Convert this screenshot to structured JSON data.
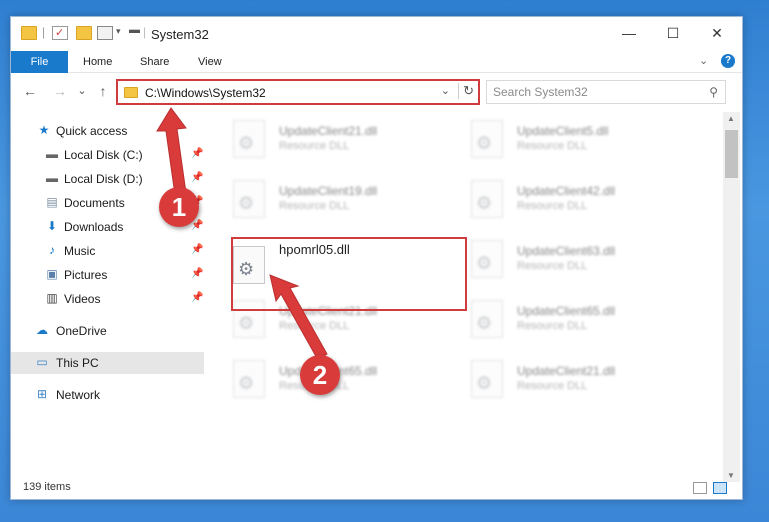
{
  "window": {
    "title": "System32",
    "controls": {
      "minimize": "—",
      "maximize": "☐",
      "close": "✕"
    }
  },
  "ribbon": {
    "tabs": [
      "File",
      "Home",
      "Share",
      "View"
    ],
    "expand_glyph": "⌄",
    "help_glyph": "?"
  },
  "navigation": {
    "back": "←",
    "forward": "→",
    "recent": "⌄",
    "up": "↑",
    "address": "C:\\Windows\\System32",
    "address_dropdown": "⌄",
    "refresh": "↻",
    "search_placeholder": "Search System32"
  },
  "sidebar": {
    "items": [
      {
        "label": "Quick access",
        "icon": "star-icon",
        "pinned": false
      },
      {
        "label": "Local Disk (C:)",
        "icon": "drive-icon",
        "pinned": true
      },
      {
        "label": "Local Disk (D:)",
        "icon": "drive-icon",
        "pinned": true
      },
      {
        "label": "Documents",
        "icon": "document-icon",
        "pinned": true
      },
      {
        "label": "Downloads",
        "icon": "download-icon",
        "pinned": true
      },
      {
        "label": "Music",
        "icon": "music-icon",
        "pinned": true
      },
      {
        "label": "Pictures",
        "icon": "picture-icon",
        "pinned": true
      },
      {
        "label": "Videos",
        "icon": "video-icon",
        "pinned": true
      },
      {
        "label": "OneDrive",
        "icon": "cloud-icon",
        "pinned": false
      },
      {
        "label": "This PC",
        "icon": "computer-icon",
        "pinned": false,
        "selected": true
      },
      {
        "label": "Network",
        "icon": "network-icon",
        "pinned": false
      }
    ]
  },
  "files": {
    "left_column": [
      {
        "name": "UpdateClient21.dll",
        "type": "Resource DLL"
      },
      {
        "name": "UpdateClient19.dll",
        "type": "Resource DLL"
      },
      {
        "name": "hpomrl05.dll",
        "type": ""
      },
      {
        "name": "UpdateClient21.dll",
        "type": "Resource DLL"
      },
      {
        "name": "UpdateClient65.dll",
        "type": "Resource DLL"
      }
    ],
    "right_column": [
      {
        "name": "UpdateClient5.dll",
        "type": "Resource DLL"
      },
      {
        "name": "UpdateClient42.dll",
        "type": "Resource DLL"
      },
      {
        "name": "UpdateClient63.dll",
        "type": "Resource DLL"
      },
      {
        "name": "UpdateClient65.dll",
        "type": "Resource DLL"
      },
      {
        "name": "UpdateClient21.dll",
        "type": "Resource DLL"
      }
    ]
  },
  "status": {
    "item_count": "139 items"
  },
  "annotations": {
    "step1": "1",
    "step2": "2"
  },
  "colors": {
    "accent": "#1979ca",
    "highlight": "#d23b3b",
    "callout": "#d93b3b"
  }
}
